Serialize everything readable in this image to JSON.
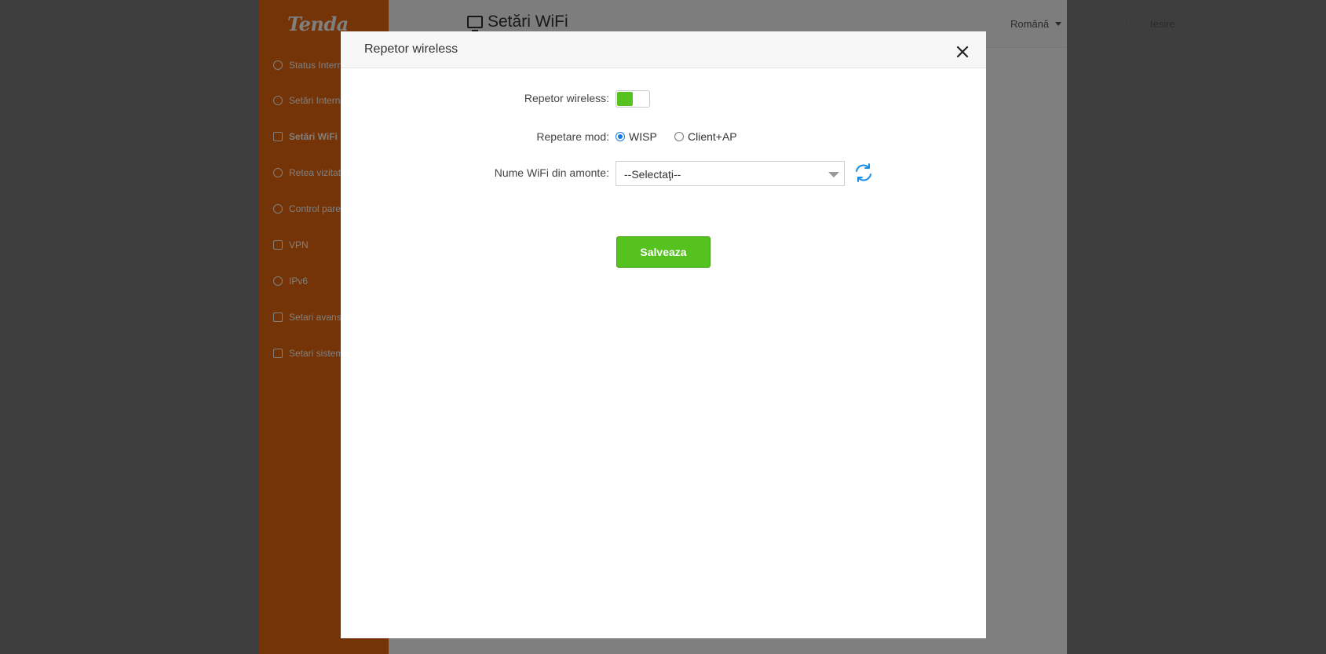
{
  "app": {
    "logo": "Tenda",
    "page_title": "Setări WiFi",
    "language": "Română",
    "separator": "|",
    "logout": "Iesire"
  },
  "sidebar": {
    "items": [
      {
        "label": "Status Internet",
        "icon": "globe-icon"
      },
      {
        "label": "Setări Internet",
        "icon": "gear-icon"
      },
      {
        "label": "Setări WiFi",
        "icon": "wifi-monitor-icon",
        "active": true
      },
      {
        "label": "Retea vizitatori",
        "icon": "guest-user-icon"
      },
      {
        "label": "Control parental",
        "icon": "parental-icon"
      },
      {
        "label": "VPN",
        "icon": "vpn-icon"
      },
      {
        "label": "IPv6",
        "icon": "ipv6-icon"
      },
      {
        "label": "Setari avansate",
        "icon": "grid-icon"
      },
      {
        "label": "Setari sistem",
        "icon": "system-icon"
      }
    ]
  },
  "modal": {
    "title": "Repetor wireless",
    "repeater_label": "Repetor wireless:",
    "repeater_enabled": true,
    "mode_label": "Repetare mod:",
    "modes": [
      {
        "label": "WISP",
        "checked": true
      },
      {
        "label": "Client+AP",
        "checked": false
      }
    ],
    "upstream_label": "Nume WiFi din amonte:",
    "upstream_select_value": "--Selectaţi--",
    "save_label": "Salveaza"
  },
  "colors": {
    "sidebar": "#e8680f",
    "accent_green": "#56c21f",
    "radio_blue": "#1677e5",
    "refresh_blue": "#1a8ee8"
  }
}
